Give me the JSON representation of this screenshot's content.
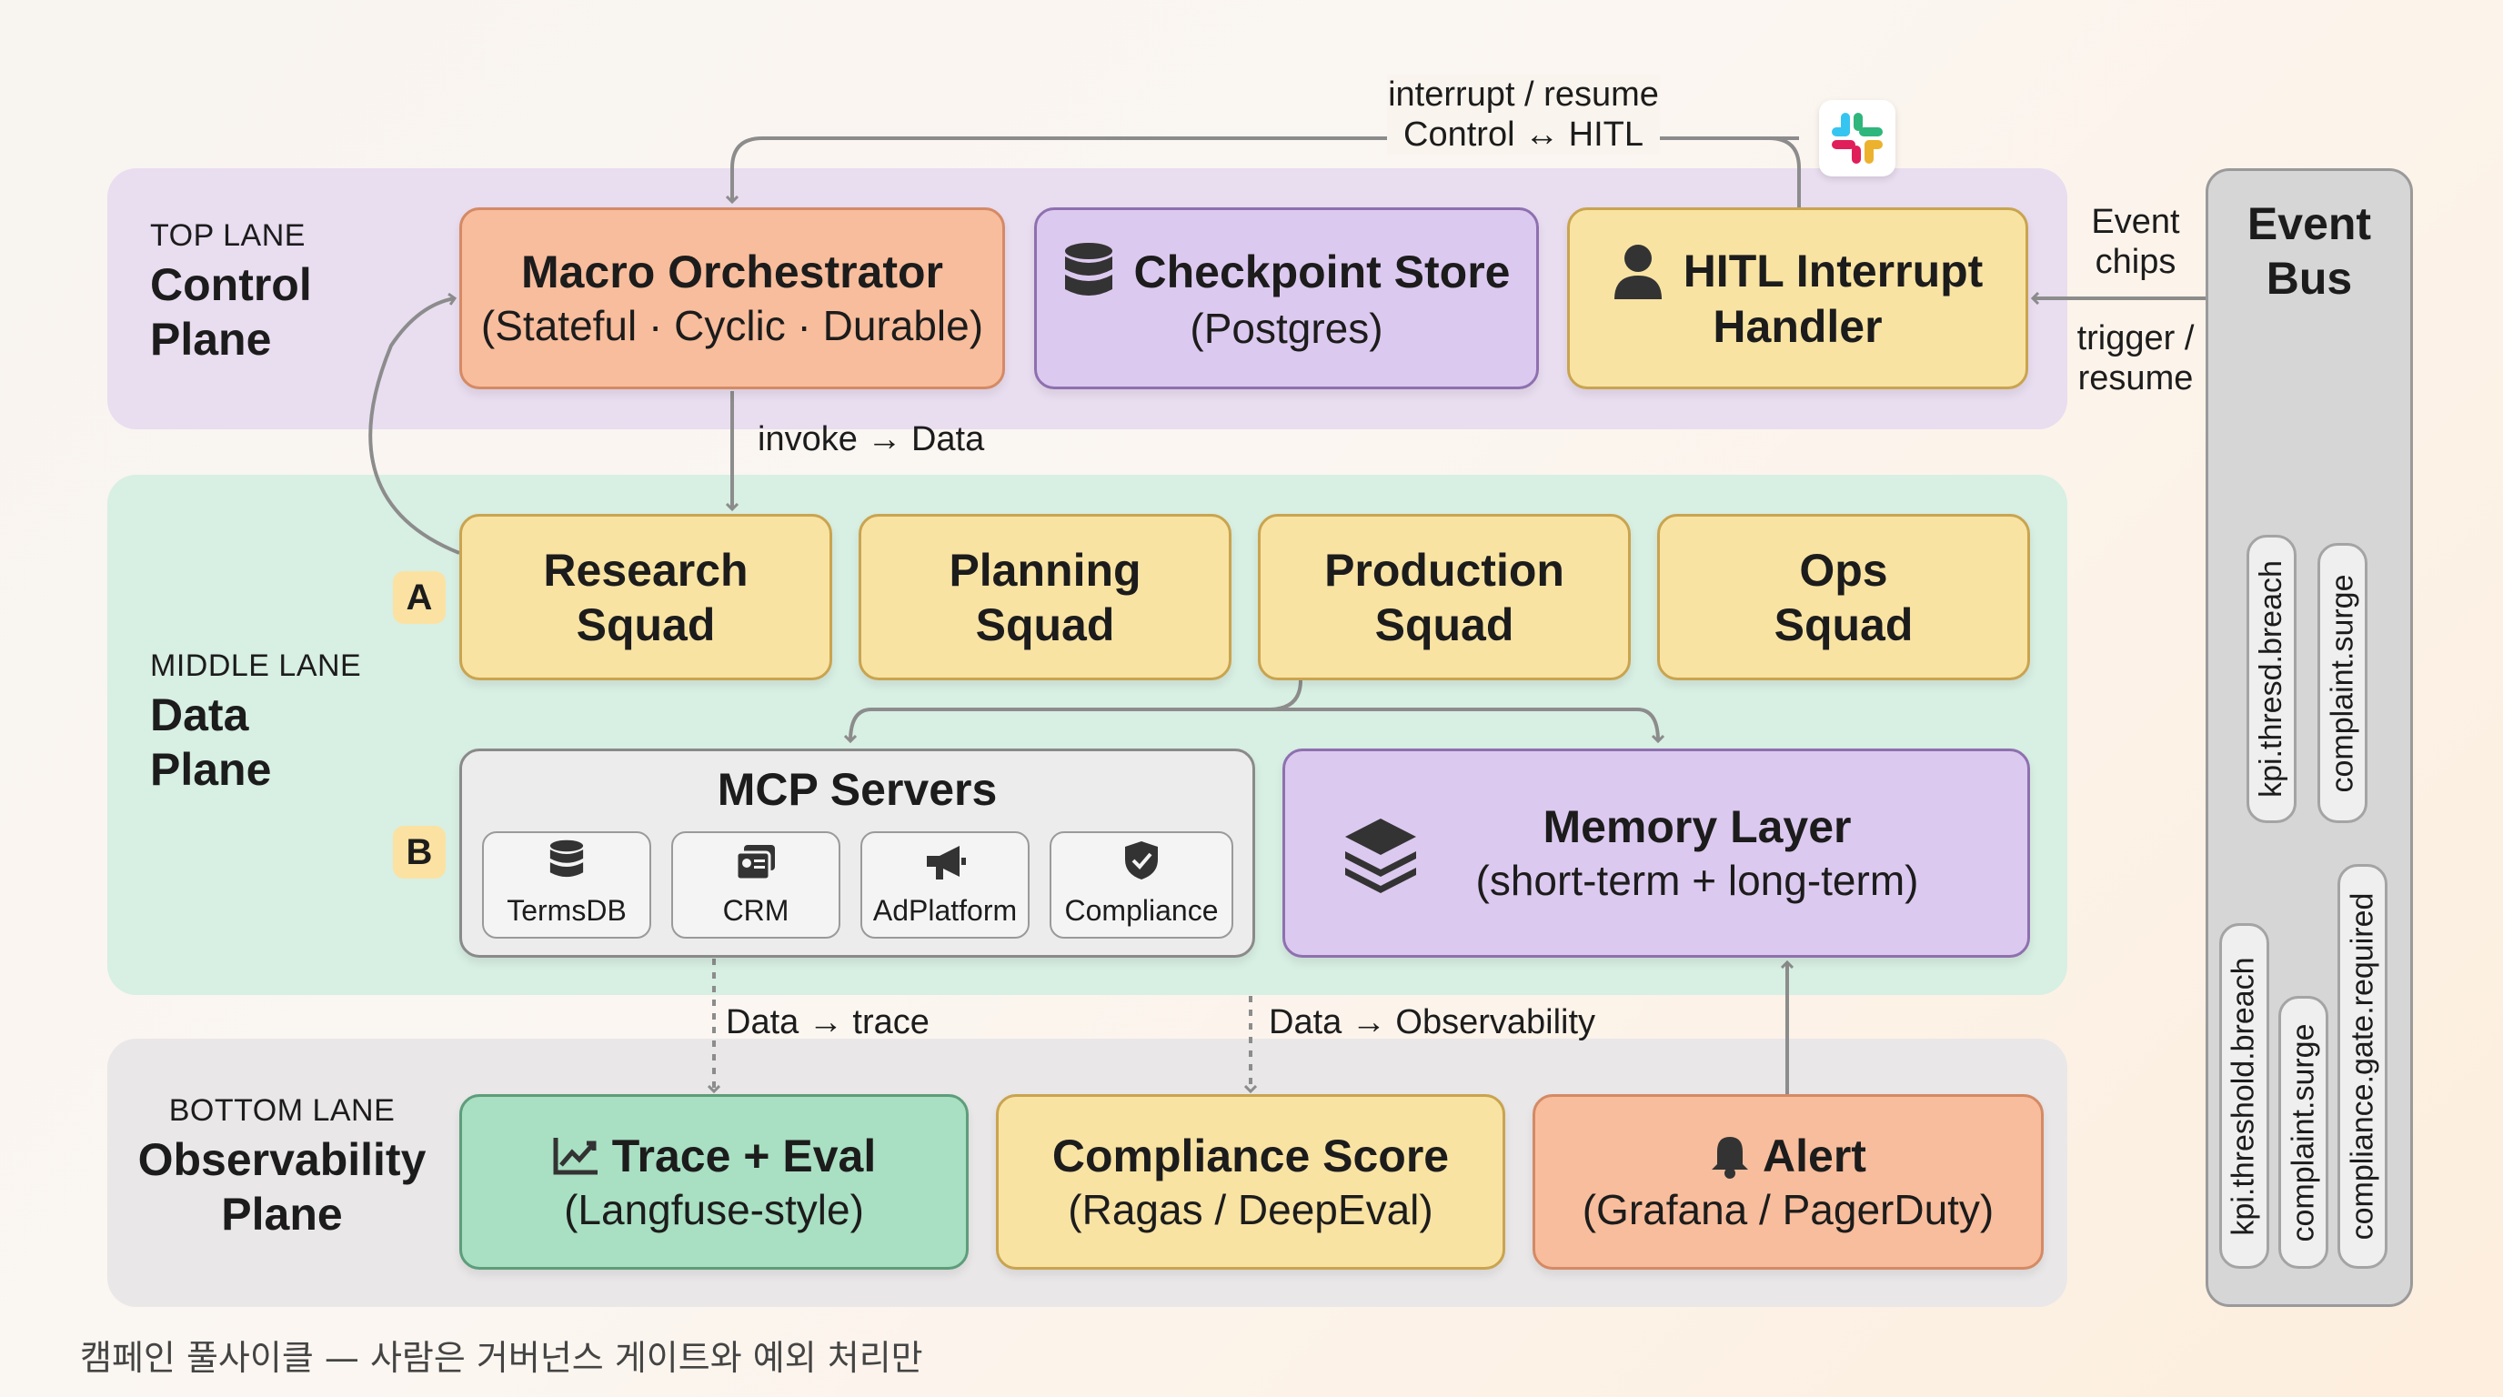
{
  "lanes": {
    "top": {
      "small": "TOP LANE",
      "line1": "Control",
      "line2": "Plane"
    },
    "middle": {
      "small": "MIDDLE LANE",
      "line1": "Data",
      "line2": "Plane"
    },
    "bottom": {
      "small": "BOTTOM LANE",
      "line1": "Observability",
      "line2": "Plane"
    }
  },
  "control": {
    "orchestrator": {
      "title": "Macro Orchestrator",
      "sub": "(Stateful · Cyclic · Durable)"
    },
    "checkpoint": {
      "title": "Checkpoint Store",
      "sub": "(Postgres)",
      "icon": "database-icon"
    },
    "hitl": {
      "line1": "HITL Interrupt",
      "line2": "Handler",
      "icon": "user-icon"
    }
  },
  "squads": [
    {
      "line1": "Research",
      "line2": "Squad"
    },
    {
      "line1": "Planning",
      "line2": "Squad"
    },
    {
      "line1": "Production",
      "line2": "Squad"
    },
    {
      "line1": "Ops",
      "line2": "Squad"
    }
  ],
  "badges": {
    "a": "A",
    "b": "B"
  },
  "mcp": {
    "title": "MCP Servers",
    "tools": [
      {
        "label": "TermsDB",
        "icon": "database-icon"
      },
      {
        "label": "CRM",
        "icon": "contacts-icon"
      },
      {
        "label": "AdPlatform",
        "icon": "megaphone-icon"
      },
      {
        "label": "Compliance",
        "icon": "shield-check-icon"
      }
    ]
  },
  "memory": {
    "title": "Memory Layer",
    "sub": "(short-term + long-term)",
    "icon": "layers-icon"
  },
  "observability": {
    "trace": {
      "title": "Trace + Eval",
      "sub": "(Langfuse-style)",
      "icon": "chart-line-icon"
    },
    "compliance": {
      "title": "Compliance Score",
      "sub": "(Ragas / DeepEval)"
    },
    "alert": {
      "title": "Alert",
      "sub": "(Grafana / PagerDuty)",
      "icon": "bell-icon"
    }
  },
  "arrows": {
    "interrupt_line1": "interrupt / resume",
    "interrupt_line2": "Control ↔ HITL",
    "invoke": "invoke → Data",
    "trace": "Data → trace",
    "observability": "Data → Observability",
    "event_chips_1": "Event",
    "event_chips_2": "chips",
    "trigger_1": "trigger /",
    "trigger_2": "resume"
  },
  "event_bus": {
    "line1": "Event",
    "line2": "Bus",
    "chips_upper": [
      "kpi.thresd.breach",
      "complaint.surge"
    ],
    "chips_lower": [
      "kpi.threshold.breach",
      "complaint.surge",
      "compliance.gate.required"
    ]
  },
  "caption": "캠페인 풀사이클 — 사람은 거버넌스 게이트와 예외 처리만",
  "colors": {
    "control_lane": "#e9ddf0",
    "data_lane": "#d8efe3",
    "observability_lane": "#e9e7e8",
    "orange": "#f8bd9c",
    "purple": "#dcc9ef",
    "yellow": "#f9e3a3",
    "green": "#a9dfc2"
  }
}
